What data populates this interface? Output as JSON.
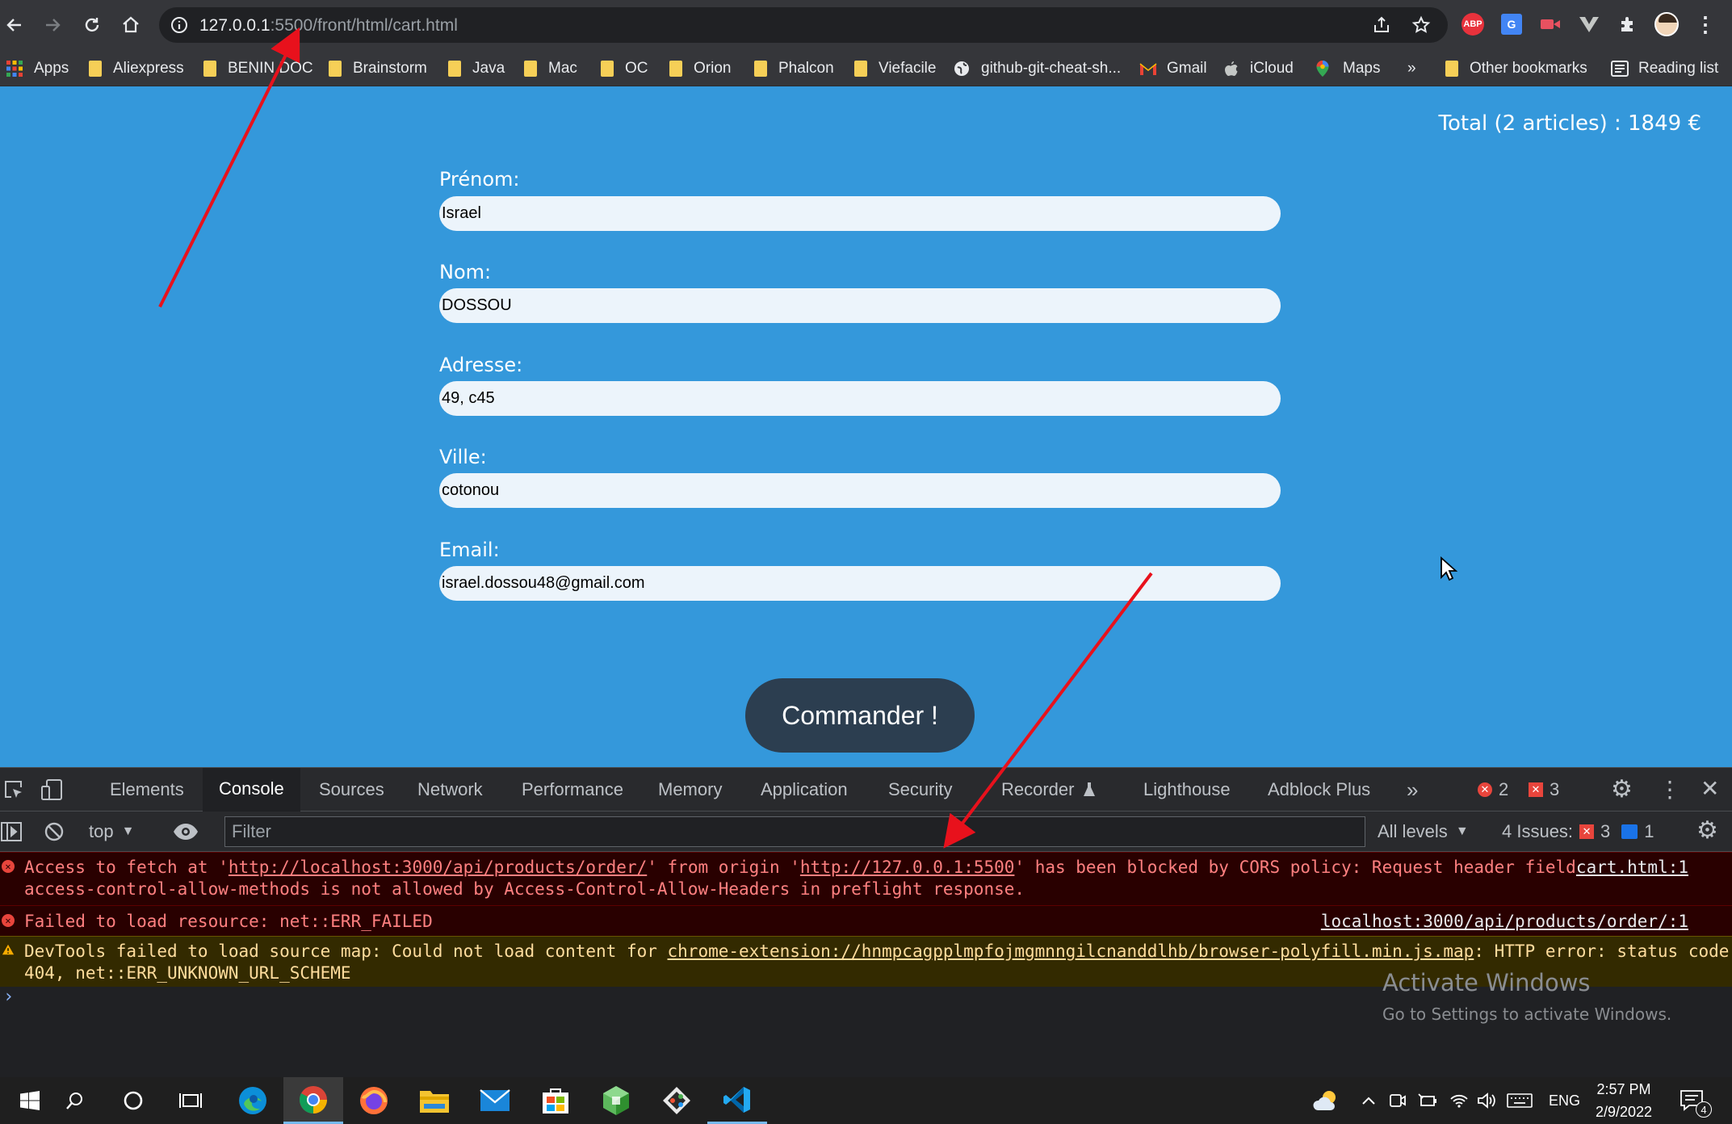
{
  "browser": {
    "url_host": "127.0.0.1",
    "url_rest": ":5500/front/html/cart.html",
    "bookmarks": [
      "Apps",
      "Aliexpress",
      "BENIN DOC",
      "Brainstorm",
      "Java",
      "Mac",
      "OC",
      "Orion",
      "Phalcon",
      "Viefacile",
      "github-git-cheat-sh...",
      "Gmail",
      "iCloud",
      "Maps",
      "»",
      "Other bookmarks",
      "Reading list"
    ],
    "ext_abp": "ABP"
  },
  "page": {
    "total": "Total (2 articles) : 1849 €",
    "fields": [
      {
        "label": "Prénom:",
        "value": "Israel"
      },
      {
        "label": "Nom:",
        "value": "DOSSOU"
      },
      {
        "label": "Adresse:",
        "value": "49, c45"
      },
      {
        "label": "Ville:",
        "value": "cotonou"
      },
      {
        "label": "Email:",
        "value": "israel.dossou48@gmail.com"
      }
    ],
    "order_button": "Commander !"
  },
  "devtools": {
    "tabs": [
      "Elements",
      "Console",
      "Sources",
      "Network",
      "Performance",
      "Memory",
      "Application",
      "Security",
      "Recorder",
      "Lighthouse",
      "Adblock Plus"
    ],
    "active_tab": "Console",
    "error_count": "2",
    "issue_count": "3",
    "context": "top",
    "filter_placeholder": "Filter",
    "levels": "All levels",
    "issues_label": "4 Issues:",
    "issues_err": "3",
    "issues_info": "1",
    "messages": [
      {
        "type": "error",
        "text_a": "Access to fetch at '",
        "link_a": "http://localhost:3000/api/products/order/",
        "text_b": "' from origin '",
        "link_b": "http://127.0.0.1:5500",
        "text_c": "' has been blocked by CORS policy: Request header field",
        "line2": "access-control-allow-methods is not allowed by Access-Control-Allow-Headers in preflight response.",
        "source": "cart.html:1"
      },
      {
        "type": "error",
        "text": "Failed to load resource: net::ERR_FAILED",
        "source": "localhost:3000/api/products/order/:1"
      },
      {
        "type": "warning",
        "text_a": "DevTools failed to load source map: Could not load content for ",
        "link": "chrome-extension://hnmpcagpplmpfojmgmnngilcnanddlhb/browser-polyfill.min.js.map",
        "text_b": ": HTTP error: status code",
        "line2": "404, net::ERR_UNKNOWN_URL_SCHEME"
      }
    ]
  },
  "watermark": {
    "title": "Activate Windows",
    "subtitle": "Go to Settings to activate Windows."
  },
  "taskbar": {
    "lang": "ENG",
    "time": "2:57 PM",
    "date": "2/9/2022",
    "notif": "4"
  },
  "colors": {
    "page_bg": "#3498db",
    "button_bg": "#2c3e50",
    "arrow": "#e8111c"
  }
}
